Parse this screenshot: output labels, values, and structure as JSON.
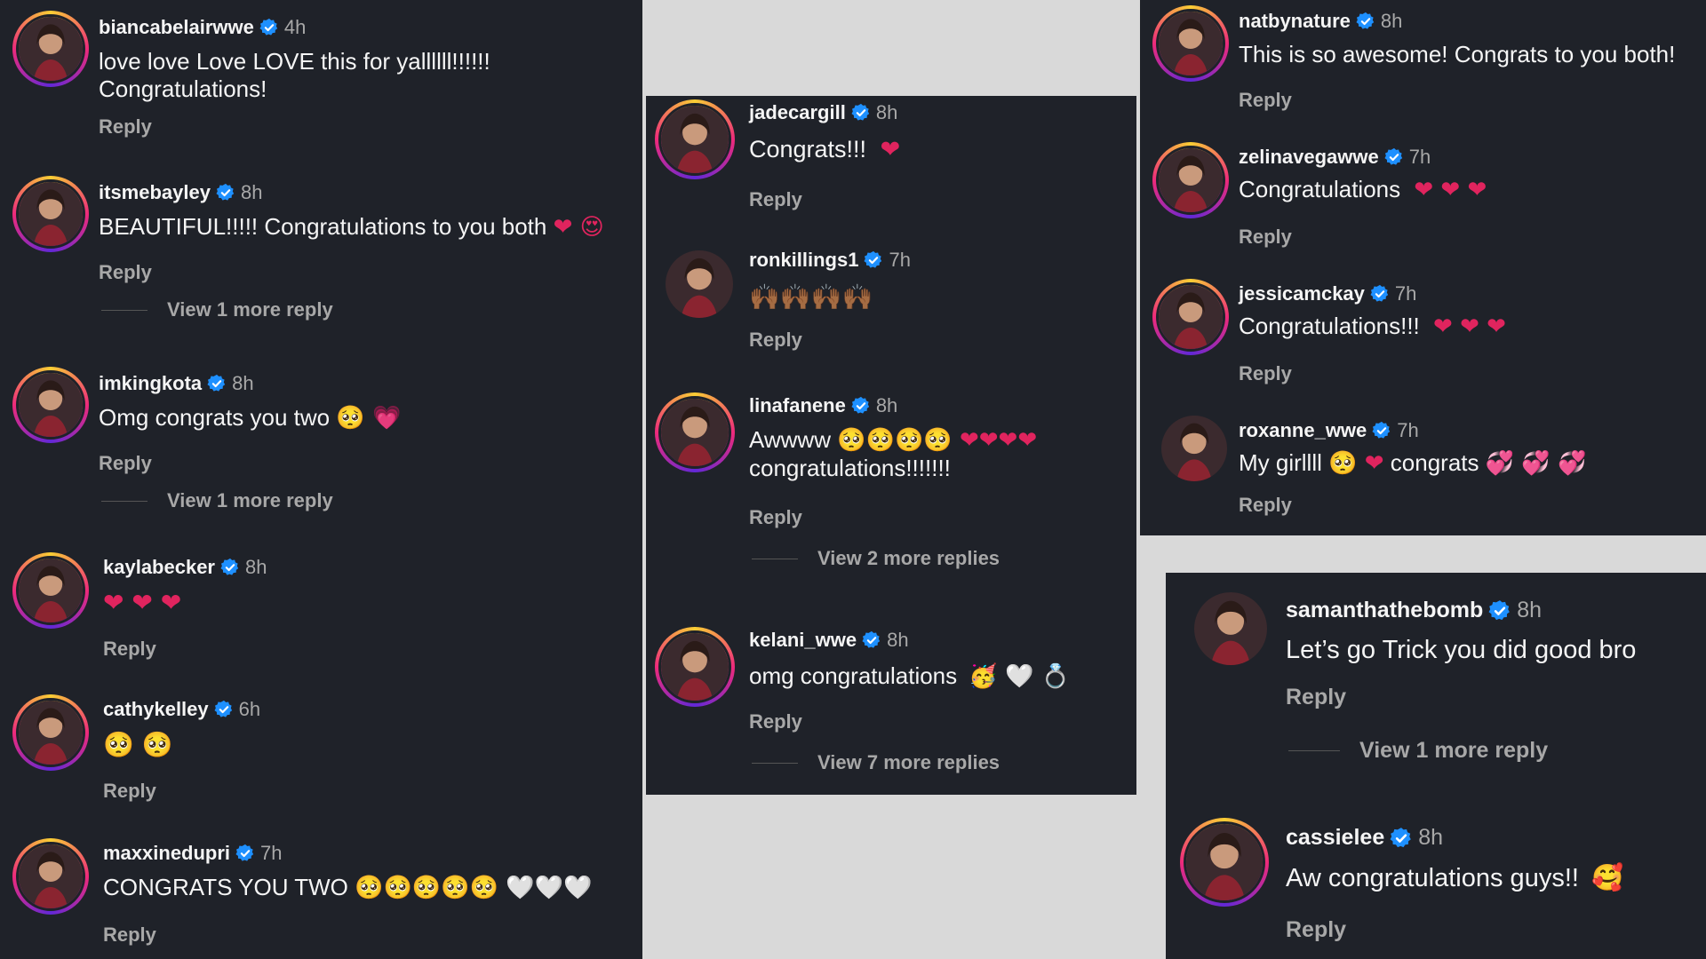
{
  "colors": {
    "panel_bg": "#1f2229",
    "page_bg": "#d9d9d9",
    "verified": "#1e90ff",
    "secondary_text": "#a8a8a8",
    "heart": "#e0245e"
  },
  "reply_label": "Reply",
  "panel1": {
    "comments": [
      {
        "username": "biancabelairwwe",
        "time": "4h",
        "text": "love love Love LOVE this for yallllll!!!!!! Congratulations!",
        "emoji": "",
        "avatar_icon": "avatar-champion"
      },
      {
        "username": "itsmebayley",
        "time": "8h",
        "text": "BEAUTIFUL!!!!! Congratulations to you both",
        "emoji": "❤ 😍",
        "avatar_icon": "avatar-group",
        "view_more": "View 1 more reply"
      },
      {
        "username": "imkingkota",
        "time": "8h",
        "text": "Omg congrats you two",
        "emoji": "🥺 💗",
        "avatar_icon": "avatar-portrait",
        "view_more": "View 1 more reply"
      },
      {
        "username": "kaylabecker",
        "time": "8h",
        "text": "",
        "emoji": "❤ ❤ ❤",
        "avatar_icon": "avatar-portrait"
      },
      {
        "username": "cathykelley",
        "time": "6h",
        "text": "",
        "emoji": "🥺 🥺",
        "avatar_icon": "avatar-portrait"
      },
      {
        "username": "maxxinedupri",
        "time": "7h",
        "text": "CONGRATS YOU TWO",
        "emoji": "🥺🥺🥺🥺🥺 🤍🤍🤍",
        "avatar_icon": "avatar-portrait"
      }
    ]
  },
  "panel2": {
    "comments": [
      {
        "username": "jadecargill",
        "time": "8h",
        "text": "Congrats!!!",
        "emoji": "❤",
        "avatar_icon": "avatar-champion"
      },
      {
        "username": "ronkillings1",
        "time": "7h",
        "text": "",
        "emoji": "🙌🏾🙌🏾🙌🏾🙌🏾",
        "avatar_icon": "avatar-portrait"
      },
      {
        "username": "linafanene",
        "time": "8h",
        "text": "Awwww",
        "text2": "congratulations!!!!!!!",
        "emoji": "🥺🥺🥺🥺 ❤❤❤❤",
        "avatar_icon": "avatar-portrait",
        "view_more": "View 2 more replies"
      },
      {
        "username": "kelani_wwe",
        "time": "8h",
        "text": "omg congratulations",
        "emoji": "🥳 🤍 💍",
        "avatar_icon": "avatar-champion",
        "view_more": "View 7 more replies"
      }
    ]
  },
  "panel3": {
    "comments": [
      {
        "username": "natbynature",
        "time": "8h",
        "text": "This is so awesome! Congrats to you both!",
        "emoji": "",
        "avatar_icon": "avatar-poster"
      },
      {
        "username": "zelinavegawwe",
        "time": "7h",
        "text": "Congratulations",
        "emoji": "❤ ❤ ❤",
        "avatar_icon": "avatar-portrait"
      },
      {
        "username": "jessicamckay",
        "time": "7h",
        "text": "Congratulations!!!",
        "emoji": "❤ ❤ ❤",
        "avatar_icon": "avatar-portrait"
      },
      {
        "username": "roxanne_wwe",
        "time": "7h",
        "text": "My girllll",
        "text2": "congrats",
        "emoji": "🥺 ❤",
        "emoji2": "💞 💞 💞",
        "avatar_icon": "avatar-portrait"
      }
    ]
  },
  "panel4": {
    "comments": [
      {
        "username": "samanthathebomb",
        "time": "8h",
        "text": "Let’s go Trick you did good bro",
        "emoji": "",
        "avatar_icon": "avatar-portrait",
        "view_more": "View 1 more reply"
      },
      {
        "username": "cassielee",
        "time": "8h",
        "text": "Aw congratulations guys!!",
        "emoji": "🥰",
        "avatar_icon": "avatar-portrait"
      }
    ]
  }
}
